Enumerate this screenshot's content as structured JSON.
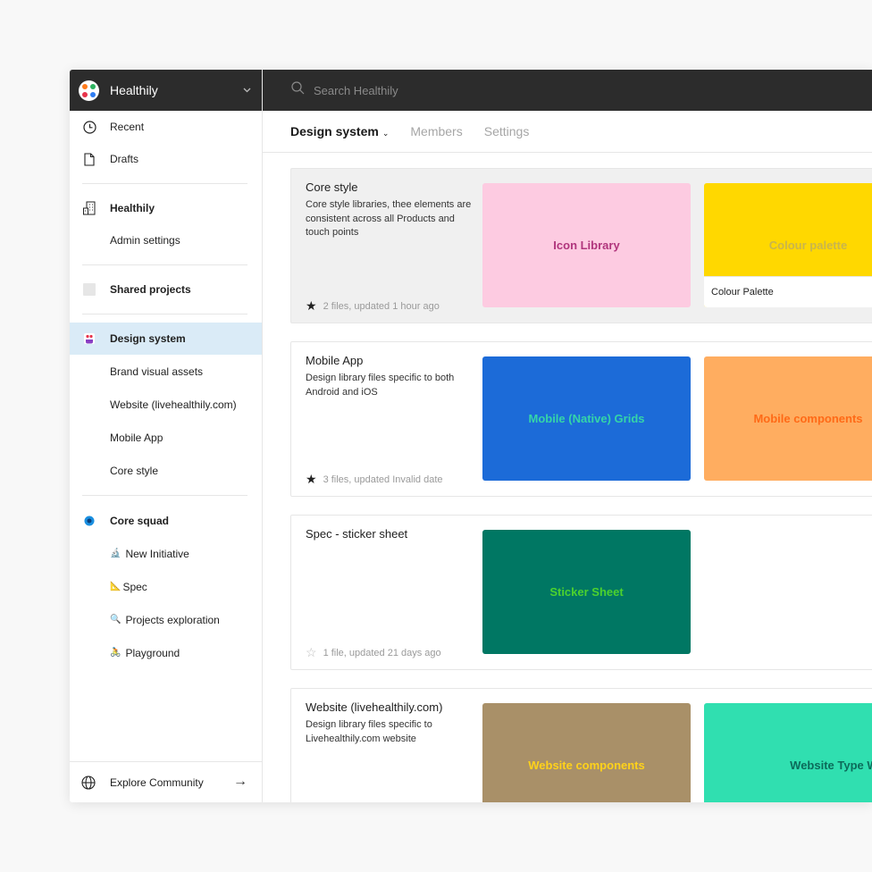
{
  "sidebar": {
    "team_name": "Healthily",
    "nav": {
      "recent": "Recent",
      "drafts": "Drafts",
      "org": "Healthily",
      "admin": "Admin settings",
      "shared": "Shared projects",
      "design_system": "Design system",
      "brand": "Brand visual assets",
      "website": "Website (livehealthily.com)",
      "mobile": "Mobile App",
      "core_style": "Core style",
      "core_squad": "Core squad",
      "new_initiative": "New Initiative",
      "spec": "Spec",
      "projects_exploration": "Projects exploration",
      "playground": "Playground"
    },
    "emoji": {
      "new_initiative": "🔬",
      "spec": "📐",
      "projects_exploration": "🔍",
      "playground": "🚴"
    },
    "explore": "Explore Community",
    "explore_arrow": "→"
  },
  "search": {
    "placeholder": "Search Healthily"
  },
  "tabs": {
    "active": "Design system",
    "active_caret": "⌄",
    "members": "Members",
    "settings": "Settings"
  },
  "cards": [
    {
      "title": "Core style",
      "desc": "Core style libraries, thee elements are consistent across all Products and touch points",
      "meta": "2 files, updated 1 hour ago",
      "starred": true,
      "thumbs": [
        {
          "label": "Icon Library",
          "bg": "#fdcbe1",
          "fg": "#b0357c"
        },
        {
          "label": "Colour palette",
          "bg": "#ffd800",
          "fg": "#c9b54d",
          "bar": "Colour Palette"
        }
      ]
    },
    {
      "title": "Mobile App",
      "desc": "Design library files specific to both Android and iOS",
      "meta": "3 files, updated Invalid date",
      "starred": true,
      "thumbs": [
        {
          "label": "Mobile (Native) Grids",
          "bg": "#1c6bd8",
          "fg": "#35d5a8"
        },
        {
          "label": "Mobile components",
          "bg": "#ffad60",
          "fg": "#ff6a17"
        }
      ]
    },
    {
      "title": "Spec - sticker sheet",
      "desc": "",
      "meta": "1 file, updated 21 days ago",
      "starred": false,
      "thumbs": [
        {
          "label": "Sticker Sheet",
          "bg": "#007763",
          "fg": "#4cd22e"
        }
      ]
    },
    {
      "title": "Website (livehealthily.com)",
      "desc": "Design library files specific to Livehealthily.com website",
      "meta": "",
      "starred": true,
      "thumbs": [
        {
          "label": "Website components",
          "bg": "#a99068",
          "fg": "#ffd21a"
        },
        {
          "label": "Website Type Waterfall",
          "bg": "#30dfb0",
          "fg": "#0c6b5a"
        }
      ]
    }
  ],
  "icons": {
    "star_filled": "★",
    "star_outline": "☆"
  }
}
